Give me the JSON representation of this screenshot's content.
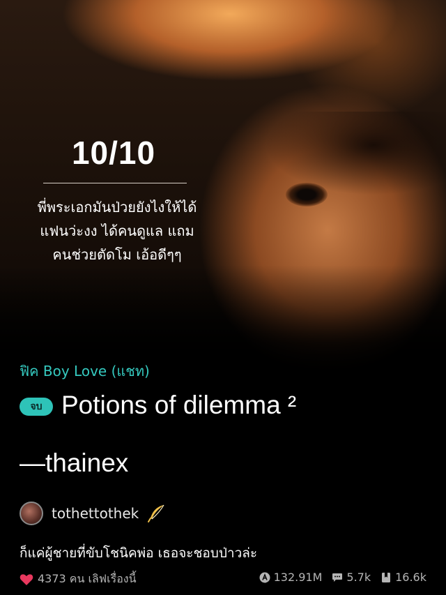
{
  "cover": {
    "rating": "10/10",
    "review_lines": [
      "พี่พระเอกมันป่วยยังไงให้ได้",
      "แฟนว่ะงง ได้คนดูแล แถม",
      "คนช่วยตัดโม เอ้อดีๆๆ"
    ]
  },
  "story": {
    "genre": "ฟิค Boy Love (แชท)",
    "status_badge": "จบ",
    "title_line1": "Potions of dilemma ²",
    "title_line2": "—thainex",
    "author": "tothettothek",
    "description": "ก็แค่ผู้ชายที่ขับโชนิคพ่อ เธอจะชอบป่าวล่ะ"
  },
  "stats": {
    "likes": "4373 คน เลิฟเรื่องนี้",
    "views": "132.91M",
    "comments": "5.7k",
    "saves": "16.6k"
  },
  "colors": {
    "accent": "#35c9bf",
    "heart": "#e8385e",
    "background": "#000000"
  },
  "icons": {
    "heart": "heart-icon",
    "views": "views-icon",
    "comments": "comment-icon",
    "saves": "bookmark-icon",
    "author_badge": "quill-icon"
  }
}
